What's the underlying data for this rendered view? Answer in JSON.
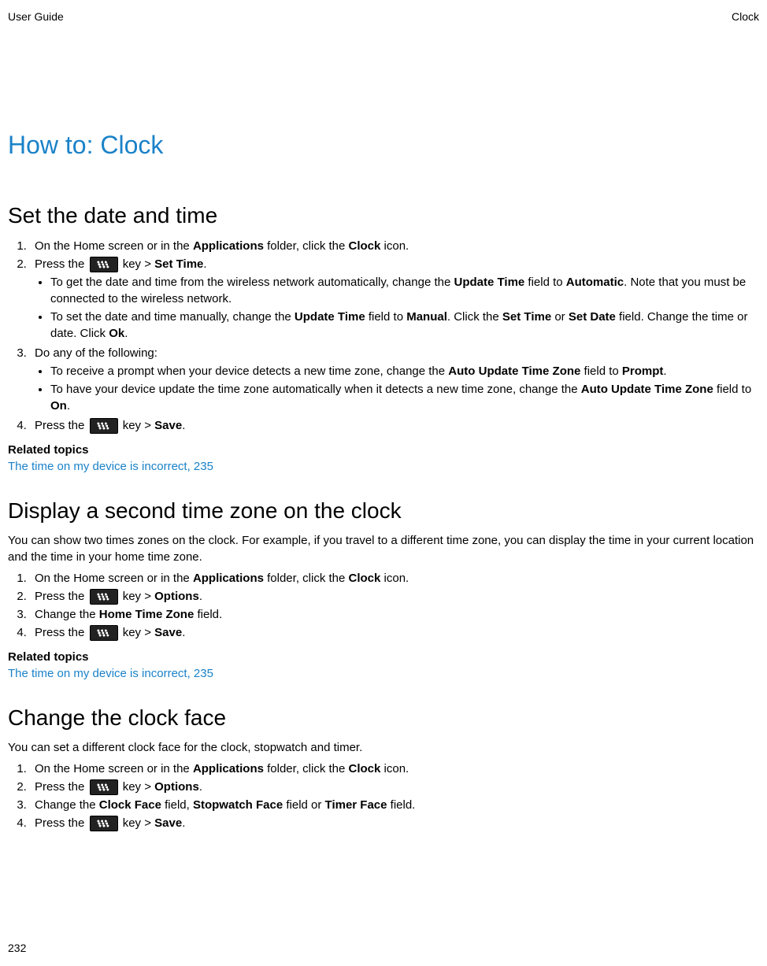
{
  "header": {
    "left": "User Guide",
    "right": "Clock"
  },
  "page_number": "232",
  "h1": "How to: Clock",
  "sections": {
    "set_date_time": {
      "title": "Set the date and time",
      "step1_a": "On the Home screen or in the ",
      "step1_b": "Applications",
      "step1_c": " folder, click the ",
      "step1_d": "Clock",
      "step1_e": " icon.",
      "step2_a": "Press the ",
      "step2_b": " key > ",
      "step2_c": "Set Time",
      "step2_d": ".",
      "bullet2a_a": "To get the date and time from the wireless network automatically, change the ",
      "bullet2a_b": "Update Time",
      "bullet2a_c": " field to ",
      "bullet2a_d": "Automatic",
      "bullet2a_e": ". Note that you must be connected to the wireless network.",
      "bullet2b_a": "To set the date and time manually, change the ",
      "bullet2b_b": "Update Time",
      "bullet2b_c": " field to ",
      "bullet2b_d": "Manual",
      "bullet2b_e": ". Click the ",
      "bullet2b_f": "Set Time",
      "bullet2b_g": " or ",
      "bullet2b_h": "Set Date",
      "bullet2b_i": " field. Change the time or date. Click ",
      "bullet2b_j": "Ok",
      "bullet2b_k": ".",
      "step3": "Do any of the following:",
      "bullet3a_a": "To receive a prompt when your device detects a new time zone, change the ",
      "bullet3a_b": "Auto Update Time Zone",
      "bullet3a_c": " field to ",
      "bullet3a_d": "Prompt",
      "bullet3a_e": ".",
      "bullet3b_a": "To have your device update the time zone automatically when it detects a new time zone, change the ",
      "bullet3b_b": "Auto Update Time Zone",
      "bullet3b_c": " field to ",
      "bullet3b_d": "On",
      "bullet3b_e": ".",
      "step4_a": "Press the ",
      "step4_b": " key > ",
      "step4_c": "Save",
      "step4_d": ".",
      "related_heading": "Related topics",
      "related_link": "The time on my device is incorrect, 235"
    },
    "second_tz": {
      "title": "Display a second time zone on the clock",
      "intro": "You can show two times zones on the clock. For example, if you travel to a different time zone, you can display the time in your current location and the time in your home time zone.",
      "step1_a": "On the Home screen or in the ",
      "step1_b": "Applications",
      "step1_c": " folder, click the ",
      "step1_d": "Clock",
      "step1_e": " icon.",
      "step2_a": "Press the ",
      "step2_b": " key > ",
      "step2_c": "Options",
      "step2_d": ".",
      "step3_a": "Change the ",
      "step3_b": "Home Time Zone",
      "step3_c": " field.",
      "step4_a": "Press the ",
      "step4_b": " key > ",
      "step4_c": "Save",
      "step4_d": ".",
      "related_heading": "Related topics",
      "related_link": "The time on my device is incorrect, 235"
    },
    "clock_face": {
      "title": "Change the clock face",
      "intro": "You can set a different clock face for the clock, stopwatch and timer.",
      "step1_a": "On the Home screen or in the ",
      "step1_b": "Applications",
      "step1_c": " folder, click the ",
      "step1_d": "Clock",
      "step1_e": " icon.",
      "step2_a": "Press the ",
      "step2_b": " key > ",
      "step2_c": "Options",
      "step2_d": ".",
      "step3_a": "Change the ",
      "step3_b": "Clock Face",
      "step3_c": " field, ",
      "step3_d": "Stopwatch Face",
      "step3_e": " field or ",
      "step3_f": "Timer Face",
      "step3_g": " field.",
      "step4_a": "Press the ",
      "step4_b": " key > ",
      "step4_c": "Save",
      "step4_d": "."
    }
  }
}
